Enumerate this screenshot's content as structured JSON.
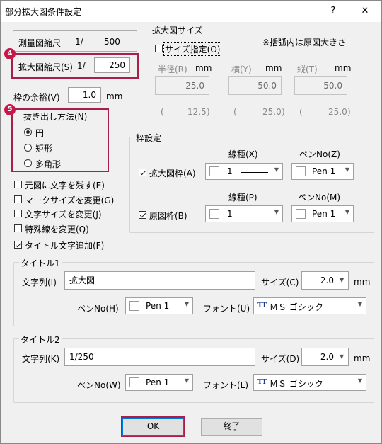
{
  "window": {
    "title": "部分拡大図条件設定",
    "help": "?",
    "close": "✕"
  },
  "scale": {
    "survey_label": "測量図縮尺",
    "survey_prefix": "1/",
    "survey_value": "500",
    "enlarged_label": "拡大図縮尺(S)",
    "enlarged_prefix": "1/",
    "enlarged_value": "250"
  },
  "margin": {
    "label": "枠の余裕(V)",
    "value": "1.0",
    "unit": "mm"
  },
  "extraction": {
    "legend": "抜き出し方法(N)",
    "options": [
      {
        "label": "円",
        "checked": true
      },
      {
        "label": "矩形",
        "checked": false
      },
      {
        "label": "多角形",
        "checked": false
      }
    ]
  },
  "checkboxes": [
    {
      "label": "元図に文字を残す(E)",
      "checked": false
    },
    {
      "label": "マークサイズを変更(G)",
      "checked": false
    },
    {
      "label": "文字サイズを変更(J)",
      "checked": false
    },
    {
      "label": "特殊線を変更(Q)",
      "checked": false
    },
    {
      "label": "タイトル文字追加(F)",
      "checked": true
    }
  ],
  "size_group": {
    "legend": "拡大図サイズ",
    "size_check_label": "サイズ指定(O)",
    "note": "※括弧内は原図大きさ",
    "radius_label": "半径(R)",
    "radius_unit": "mm",
    "radius_value": "25.0",
    "width_label": "横(Y)",
    "width_unit": "mm",
    "width_value": "50.0",
    "height_label": "縦(T)",
    "height_unit": "mm",
    "height_value": "50.0",
    "orig_radius": "12.5",
    "orig_width": "25.0",
    "orig_height": "25.0",
    "paren_open": "(",
    "paren_close": ")"
  },
  "frame": {
    "legend": "枠設定",
    "linetype_x_label": "線種(X)",
    "penno_z_label": "ペンNo(Z)",
    "enlarged_frame_label": "拡大図枠(A)",
    "enlarged_frame_checked": true,
    "enlarged_line_value": "1",
    "enlarged_pen_value": "Pen 1",
    "linetype_p_label": "線種(P)",
    "penno_m_label": "ペンNo(M)",
    "original_frame_label": "原図枠(B)",
    "original_frame_checked": true,
    "original_line_value": "1",
    "original_pen_value": "Pen 1"
  },
  "title1": {
    "legend": "タイトル1",
    "string_label": "文字列(I)",
    "string_value": "拡大図",
    "size_label": "サイズ(C)",
    "size_value": "2.0",
    "size_unit": "mm",
    "pen_label": "ペンNo(H)",
    "pen_value": "Pen 1",
    "font_label": "フォント(U)",
    "font_value": "ＭＳ ゴシック"
  },
  "title2": {
    "legend": "タイトル2",
    "string_label": "文字列(K)",
    "string_value": "1/250",
    "size_label": "サイズ(D)",
    "size_value": "2.0",
    "size_unit": "mm",
    "pen_label": "ペンNo(W)",
    "pen_value": "Pen 1",
    "font_label": "フォント(L)",
    "font_value": "ＭＳ ゴシック"
  },
  "buttons": {
    "ok": "OK",
    "close": "終了"
  },
  "badges": {
    "step4": "4",
    "step5": "5"
  },
  "icons": {
    "dropdown": "▼",
    "font_type": "TT"
  },
  "colors": {
    "highlight": "#a8204a",
    "badge": "#c8174a"
  }
}
